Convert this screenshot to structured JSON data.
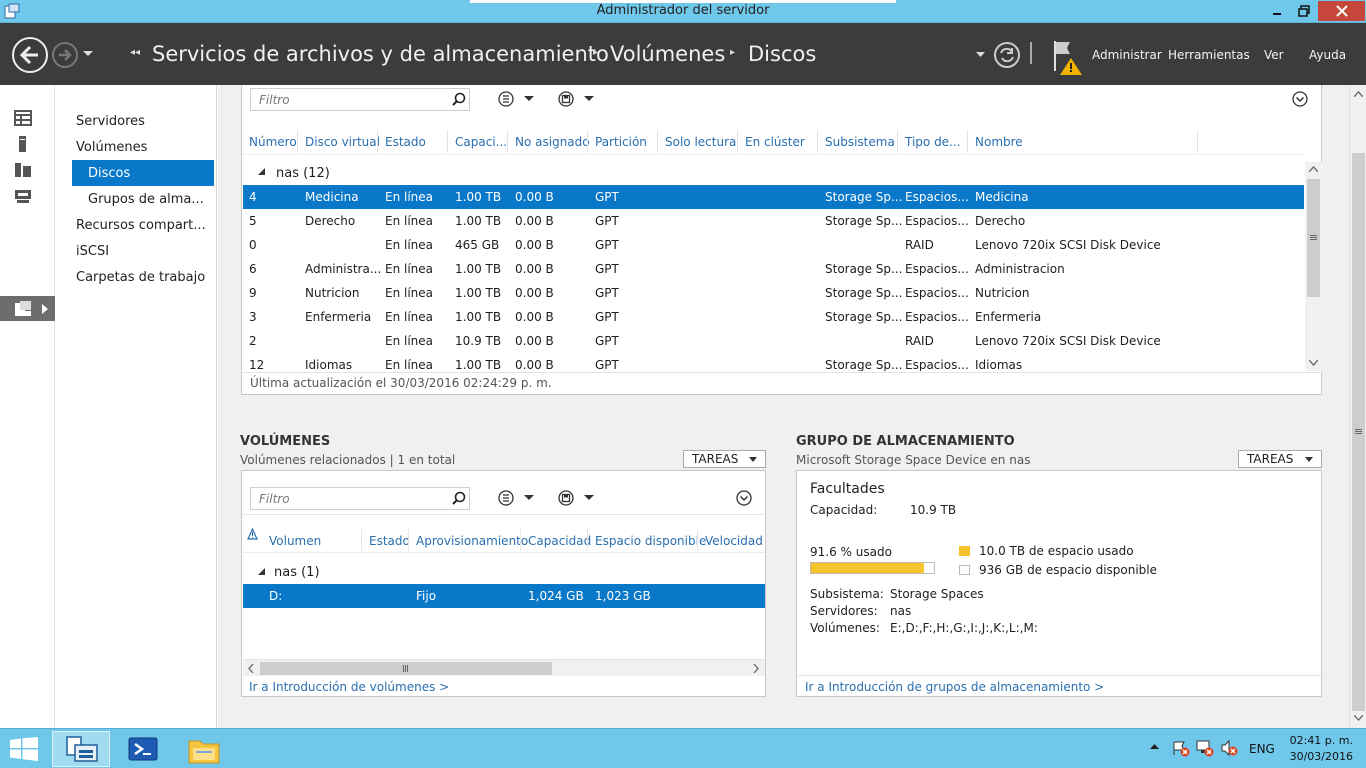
{
  "window": {
    "title": "Administrador del servidor",
    "controls": [
      "minimize",
      "maximize",
      "close"
    ]
  },
  "header": {
    "breadcrumb": [
      "Servicios de archivos y de almacenamiento",
      "Volúmenes",
      "Discos"
    ],
    "menu": [
      "Administrar",
      "Herramientas",
      "Ver",
      "Ayuda"
    ]
  },
  "nav": {
    "items": [
      "Servidores",
      "Volúmenes",
      "Discos",
      "Grupos de alma...",
      "Recursos compart...",
      "iSCSI",
      "Carpetas de trabajo"
    ],
    "selected": "Discos"
  },
  "disks": {
    "filter_placeholder": "Filtro",
    "columns": [
      "Número",
      "Disco virtual",
      "Estado",
      "Capaci...",
      "No asignado",
      "Partición",
      "Solo lectura",
      "En clúster",
      "Subsistema",
      "Tipo de...",
      "Nombre"
    ],
    "group": "nas (12)",
    "rows": [
      {
        "num": "4",
        "vdisk": "Medicina",
        "state": "En línea",
        "cap": "1.00 TB",
        "unalloc": "0.00 B",
        "part": "GPT",
        "sub": "Storage Sp...",
        "type": "Espacios...",
        "name": "Medicina",
        "selected": true
      },
      {
        "num": "5",
        "vdisk": "Derecho",
        "state": "En línea",
        "cap": "1.00 TB",
        "unalloc": "0.00 B",
        "part": "GPT",
        "sub": "Storage Sp...",
        "type": "Espacios...",
        "name": "Derecho"
      },
      {
        "num": "0",
        "vdisk": "",
        "state": "En línea",
        "cap": "465 GB",
        "unalloc": "0.00 B",
        "part": "GPT",
        "sub": "",
        "type": "RAID",
        "name": "Lenovo 720ix SCSI Disk Device"
      },
      {
        "num": "6",
        "vdisk": "Administra...",
        "state": "En línea",
        "cap": "1.00 TB",
        "unalloc": "0.00 B",
        "part": "GPT",
        "sub": "Storage Sp...",
        "type": "Espacios...",
        "name": "Administracion"
      },
      {
        "num": "9",
        "vdisk": "Nutricion",
        "state": "En línea",
        "cap": "1.00 TB",
        "unalloc": "0.00 B",
        "part": "GPT",
        "sub": "Storage Sp...",
        "type": "Espacios...",
        "name": "Nutricion"
      },
      {
        "num": "3",
        "vdisk": "Enfermeria",
        "state": "En línea",
        "cap": "1.00 TB",
        "unalloc": "0.00 B",
        "part": "GPT",
        "sub": "Storage Sp...",
        "type": "Espacios...",
        "name": "Enfermeria"
      },
      {
        "num": "2",
        "vdisk": "",
        "state": "En línea",
        "cap": "10.9 TB",
        "unalloc": "0.00 B",
        "part": "GPT",
        "sub": "",
        "type": "RAID",
        "name": "Lenovo 720ix SCSI Disk Device"
      },
      {
        "num": "12",
        "vdisk": "Idiomas",
        "state": "En línea",
        "cap": "1.00 TB",
        "unalloc": "0.00 B",
        "part": "GPT",
        "sub": "Storage Sp...",
        "type": "Espacios...",
        "name": "Idiomas"
      }
    ],
    "last_update": "Última actualización el 30/03/2016 02:24:29 p. m."
  },
  "volumes": {
    "title": "VOLÚMENES",
    "subtitle": "Volúmenes relacionados | 1 en total",
    "tasks": "TAREAS",
    "filter_placeholder": "Filtro",
    "columns": [
      "Volumen",
      "Estado",
      "Aprovisionamiento",
      "Capacidad",
      "Espacio disponible",
      "Velocidad d"
    ],
    "group": "nas (1)",
    "rows": [
      {
        "vol": "D:",
        "state": "",
        "prov": "Fijo",
        "cap": "1,024 GB",
        "free": "1,023 GB"
      }
    ],
    "link": "Ir a Introducción de volúmenes >"
  },
  "pool": {
    "title": "GRUPO DE ALMACENAMIENTO",
    "subtitle": "Microsoft Storage Space Device en nas",
    "tasks": "TAREAS",
    "name": "Facultades",
    "capacity_label": "Capacidad:",
    "capacity": "10.9 TB",
    "used_label": "91.6 % usado",
    "used_fraction": 0.916,
    "legend_used": "10.0 TB de espacio usado",
    "legend_free": "936 GB de espacio disponible",
    "used_color": "#f5c42c",
    "details": [
      {
        "label": "Subsistema:",
        "value": "Storage Spaces"
      },
      {
        "label": "Servidores:",
        "value": "nas"
      },
      {
        "label": "Volúmenes:",
        "value": "E:,D:,F:,H:,G:,I:,J:,K:,L:,M:"
      }
    ],
    "link": "Ir a Introducción de grupos de almacenamiento >"
  },
  "taskbar": {
    "lang": "ENG",
    "time": "02:41 p. m.",
    "date": "30/03/2016"
  }
}
